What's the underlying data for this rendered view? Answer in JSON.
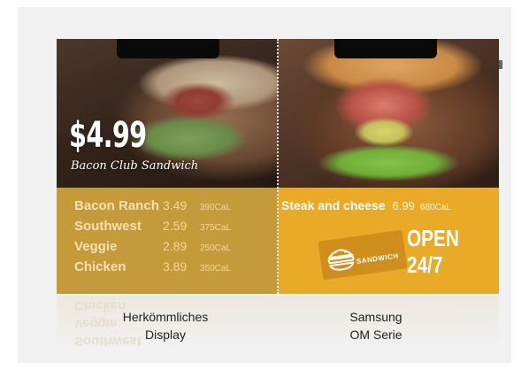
{
  "left_panel": {
    "price": "$4.99",
    "product": "Bacon Club Sandwich",
    "menu": [
      {
        "name": "Bacon Ranch",
        "price": "3.49",
        "cal": "390CaL"
      },
      {
        "name": "Southwest",
        "price": "2.59",
        "cal": "375CaL"
      },
      {
        "name": "Veggie",
        "price": "2.89",
        "cal": "250CaL"
      },
      {
        "name": "Chicken",
        "price": "3.89",
        "cal": "350CaL"
      }
    ]
  },
  "right_panel": {
    "item": {
      "name": "Steak and cheese",
      "price": "6.99",
      "cal": "680CaL"
    },
    "logo_word": "SANDWICH",
    "open_line1": "OPEN",
    "open_line2": "24/7"
  },
  "captions": {
    "left_line1": "Herkömmliches",
    "left_line2": "Display",
    "right_line1": "Samsung",
    "right_line2": "OM Serie"
  },
  "colors": {
    "left_menu_bg": "#c49a3a",
    "right_menu_bg": "#e9aa28"
  }
}
